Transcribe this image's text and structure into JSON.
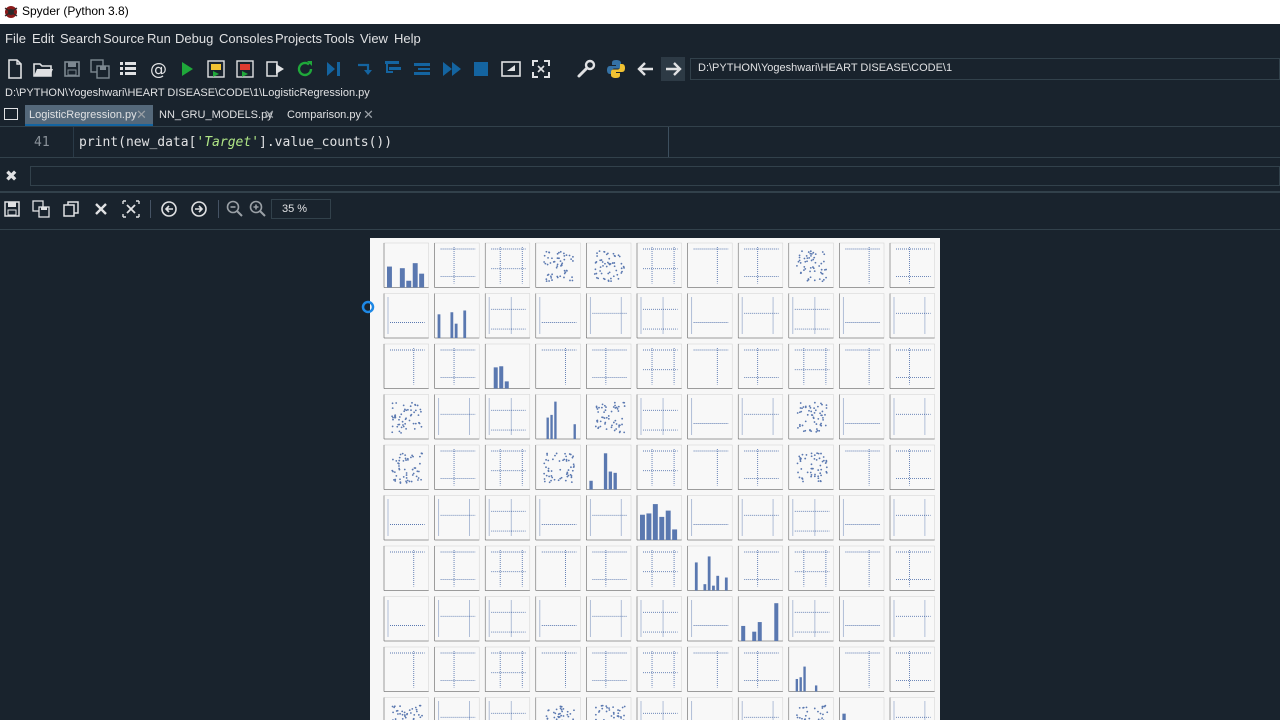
{
  "window": {
    "title": "Spyder (Python 3.8)"
  },
  "menu": [
    "File",
    "Edit",
    "Search",
    "Source",
    "Run",
    "Debug",
    "Consoles",
    "Projects",
    "Tools",
    "View",
    "Help"
  ],
  "toolbar": {
    "working_directory": "D:\\PYTHON\\Yogeshwari\\HEART DISEASE\\CODE\\1"
  },
  "editor": {
    "file_path": "D:\\PYTHON\\Yogeshwari\\HEART DISEASE\\CODE\\1\\LogisticRegression.py",
    "tabs": [
      {
        "label": "LogisticRegression.py",
        "active": true
      },
      {
        "label": "NN_GRU_MODELS.py",
        "active": false
      },
      {
        "label": "Comparison.py",
        "active": false
      }
    ],
    "line_number": "41",
    "code_prefix": "print(new_data[",
    "code_string": "'Target'",
    "code_suffix": "].value_counts())"
  },
  "plots": {
    "zoom": "35 %",
    "figure": {
      "type": "pairplot",
      "grid_rows": 10,
      "grid_cols": 11,
      "marker_color": "#5a78b0"
    }
  },
  "colors": {
    "background": "#19232d",
    "accent": "#1464a0",
    "tab_active": "#54687a"
  }
}
